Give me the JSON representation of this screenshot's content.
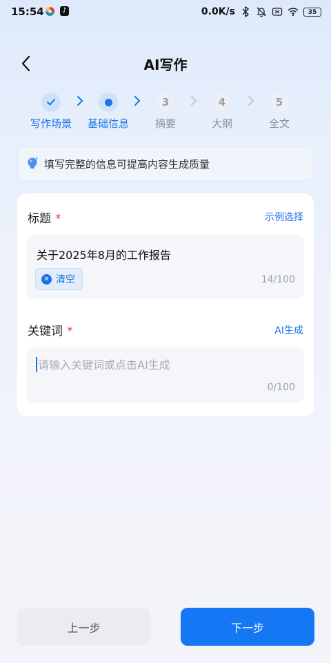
{
  "status_bar": {
    "time": "15:54",
    "network_speed": "0.0K/s",
    "battery": "35"
  },
  "header": {
    "title": "AI写作"
  },
  "steps": [
    {
      "label": "写作场景",
      "state": "done",
      "number": ""
    },
    {
      "label": "基础信息",
      "state": "active",
      "number": ""
    },
    {
      "label": "摘要",
      "state": "todo",
      "number": "3"
    },
    {
      "label": "大纲",
      "state": "todo",
      "number": "4"
    },
    {
      "label": "全文",
      "state": "todo",
      "number": "5"
    }
  ],
  "tip": {
    "text": "填写完整的信息可提高内容生成质量"
  },
  "form": {
    "title_label": "标题",
    "required_mark": "*",
    "title_example_link": "示例选择",
    "title_value": "关于2025年8月的工作报告",
    "clear_label": "清空",
    "title_counter": "14/100",
    "keyword_label": "关键词",
    "keyword_ai_link": "AI生成",
    "keyword_value": "",
    "keyword_placeholder": "请输入关键词或点击AI生成",
    "keyword_counter": "0/100"
  },
  "footer": {
    "prev_label": "上一步",
    "next_label": "下一步"
  },
  "colors": {
    "accent": "#1a73e8",
    "primary_button": "#1677f5",
    "required": "#e53935"
  }
}
